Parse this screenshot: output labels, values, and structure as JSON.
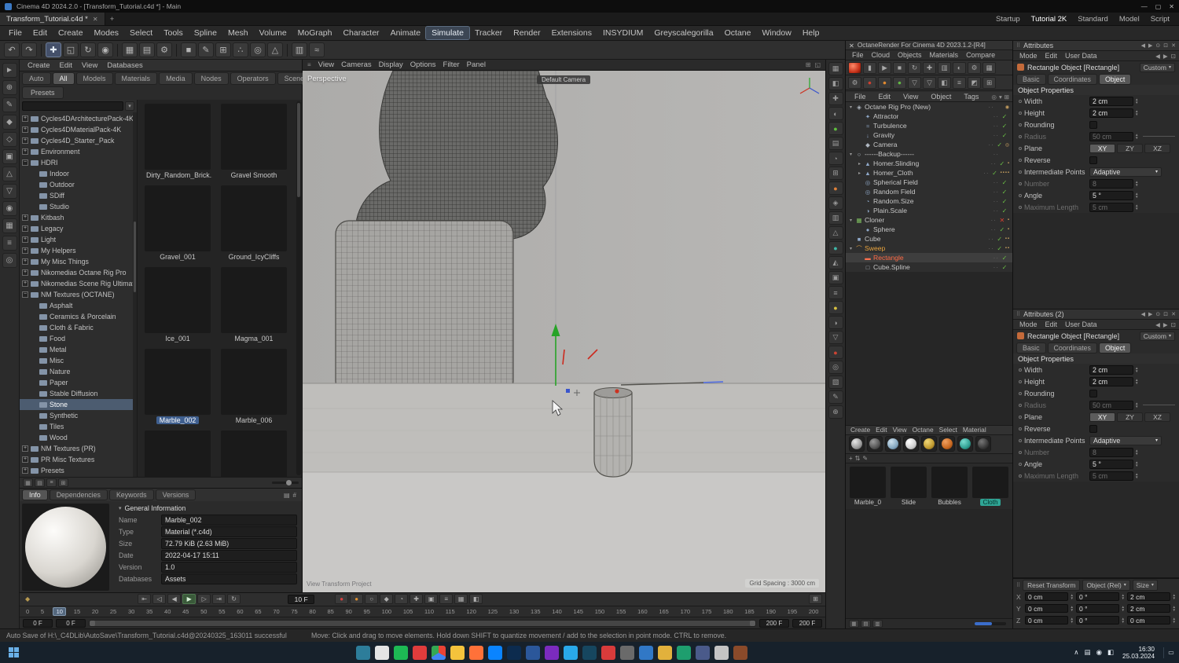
{
  "titlebar": {
    "title": "Cinema 4D 2024.2.0 - [Transform_Tutorial.c4d *] - Main",
    "min": "—",
    "max": "▢",
    "close": "✕"
  },
  "doc_tab": {
    "label": "Transform_Tutorial.c4d *",
    "close": "✕",
    "new": "+"
  },
  "layout_tabs": [
    {
      "label": "Startup"
    },
    {
      "label": "Tutorial 2K",
      "active": true
    },
    {
      "label": "Standard"
    },
    {
      "label": "Model"
    },
    {
      "label": "Script"
    }
  ],
  "menubar": {
    "items": [
      {
        "label": "File"
      },
      {
        "label": "Edit"
      },
      {
        "label": "Create"
      },
      {
        "label": "Modes"
      },
      {
        "label": "Select"
      },
      {
        "label": "Tools"
      },
      {
        "label": "Spline"
      },
      {
        "label": "Mesh"
      },
      {
        "label": "Volume"
      },
      {
        "label": "MoGraph"
      },
      {
        "label": "Character"
      },
      {
        "label": "Animate"
      },
      {
        "label": "Simulate",
        "active": true
      },
      {
        "label": "Tracker"
      },
      {
        "label": "Render"
      },
      {
        "label": "Extensions"
      },
      {
        "label": "INSYDIUM"
      },
      {
        "label": "Greyscalegorilla"
      },
      {
        "label": "Octane"
      },
      {
        "label": "Window"
      },
      {
        "label": "Help"
      }
    ]
  },
  "toolbar": {
    "items": [
      {
        "g": "↶"
      },
      {
        "g": "↷"
      },
      {
        "sep": true
      },
      {
        "g": "✚",
        "hl": true
      },
      {
        "g": "◱"
      },
      {
        "g": "↻"
      },
      {
        "g": "◉"
      },
      {
        "sep": true
      },
      {
        "g": "▦"
      },
      {
        "g": "▤"
      },
      {
        "g": "⚙"
      },
      {
        "sep": true
      },
      {
        "g": "■"
      },
      {
        "g": "✎"
      },
      {
        "g": "⊞"
      },
      {
        "g": "∴"
      },
      {
        "g": "◎"
      },
      {
        "g": "△"
      },
      {
        "sep": true
      },
      {
        "g": "▥"
      },
      {
        "g": "≈"
      }
    ]
  },
  "left_tools": {
    "items": [
      {
        "g": "►"
      },
      {
        "g": "⊕"
      },
      {
        "g": "✎"
      },
      {
        "g": "◆"
      },
      {
        "g": "◇"
      },
      {
        "g": "▣"
      },
      {
        "g": "△"
      },
      {
        "g": "▽"
      },
      {
        "g": "◉"
      },
      {
        "g": "▦"
      },
      {
        "g": "≡"
      },
      {
        "g": "◎"
      }
    ]
  },
  "browser": {
    "menus": [
      "Create",
      "Edit",
      "View",
      "Databases"
    ],
    "tabs": [
      {
        "label": "Auto"
      },
      {
        "label": "All",
        "sel": true
      },
      {
        "label": "Models"
      },
      {
        "label": "Materials"
      },
      {
        "label": "Media"
      },
      {
        "label": "Nodes"
      },
      {
        "label": "Operators"
      },
      {
        "label": "Scenes"
      }
    ],
    "presets_label": "Presets",
    "tree": [
      {
        "label": "Cycles4DArchitecturePack-4K",
        "depth": 0,
        "exp": "+"
      },
      {
        "label": "Cycles4DMaterialPack-4K",
        "depth": 0,
        "exp": "+"
      },
      {
        "label": "Cycles4D_Starter_Pack",
        "depth": 0,
        "exp": "+"
      },
      {
        "label": "Environment",
        "depth": 0,
        "exp": "+"
      },
      {
        "label": "HDRI",
        "depth": 0,
        "exp": "−"
      },
      {
        "label": "Indoor",
        "depth": 1,
        "exp": ""
      },
      {
        "label": "Outdoor",
        "depth": 1,
        "exp": ""
      },
      {
        "label": "SDiff",
        "depth": 1,
        "exp": ""
      },
      {
        "label": "Studio",
        "depth": 1,
        "exp": ""
      },
      {
        "label": "Kitbash",
        "depth": 0,
        "exp": "+"
      },
      {
        "label": "Legacy",
        "depth": 0,
        "exp": "+"
      },
      {
        "label": "Light",
        "depth": 0,
        "exp": "+"
      },
      {
        "label": "My Helpers",
        "depth": 0,
        "exp": "+"
      },
      {
        "label": "My Misc Things",
        "depth": 0,
        "exp": "+"
      },
      {
        "label": "Nikomedias Octane Rig Pro",
        "depth": 0,
        "exp": "+"
      },
      {
        "label": "Nikomedias Scene Rig Ultimate",
        "depth": 0,
        "exp": "+"
      },
      {
        "label": "NM Textures (OCTANE)",
        "depth": 0,
        "exp": "−"
      },
      {
        "label": "Asphalt",
        "depth": 1,
        "exp": ""
      },
      {
        "label": "Ceramics & Porcelain",
        "depth": 1,
        "exp": ""
      },
      {
        "label": "Cloth & Fabric",
        "depth": 1,
        "exp": ""
      },
      {
        "label": "Food",
        "depth": 1,
        "exp": ""
      },
      {
        "label": "Metal",
        "depth": 1,
        "exp": ""
      },
      {
        "label": "Misc",
        "depth": 1,
        "exp": ""
      },
      {
        "label": "Nature",
        "depth": 1,
        "exp": ""
      },
      {
        "label": "Paper",
        "depth": 1,
        "exp": ""
      },
      {
        "label": "Stable Diffusion",
        "depth": 1,
        "exp": ""
      },
      {
        "label": "Stone",
        "depth": 1,
        "exp": "",
        "selected": true
      },
      {
        "label": "Synthetic",
        "depth": 1,
        "exp": ""
      },
      {
        "label": "Tiles",
        "depth": 1,
        "exp": ""
      },
      {
        "label": "Wood",
        "depth": 1,
        "exp": ""
      },
      {
        "label": "NM Textures (PR)",
        "depth": 0,
        "exp": "+"
      },
      {
        "label": "PR Misc Textures",
        "depth": 0,
        "exp": "+"
      },
      {
        "label": "Presets",
        "depth": 0,
        "exp": "+"
      }
    ],
    "materials": [
      {
        "label": "Dirty_Random_Brick...",
        "cls": "g1"
      },
      {
        "label": "Gravel Smooth",
        "cls": "g2"
      },
      {
        "label": "Gravel_001",
        "cls": "g3"
      },
      {
        "label": "Ground_IcyCliffs",
        "cls": "g4"
      },
      {
        "label": "Ice_001",
        "cls": "g5"
      },
      {
        "label": "Magma_001",
        "cls": "g6"
      },
      {
        "label": "Marble_002",
        "cls": "g7",
        "selected": true
      },
      {
        "label": "Marble_006",
        "cls": "g8"
      },
      {
        "label": "",
        "cls": "g9"
      },
      {
        "label": "",
        "cls": "g10"
      }
    ],
    "footer_icons": [
      {
        "g": "▦"
      },
      {
        "g": "▤"
      },
      {
        "g": "≡"
      },
      {
        "g": "⊞"
      }
    ],
    "info": {
      "tabs": [
        {
          "label": "Info",
          "sel": true
        },
        {
          "label": "Dependencies"
        },
        {
          "label": "Keywords"
        },
        {
          "label": "Versions"
        }
      ],
      "section": "General Information",
      "rows": [
        {
          "k": "Name",
          "v": "Marble_002"
        },
        {
          "k": "Type",
          "v": "Material (*.c4d)"
        },
        {
          "k": "Size",
          "v": "72.79 KiB (2.63 MiB)"
        },
        {
          "k": "Date",
          "v": "2022-04-17 15:11"
        },
        {
          "k": "Version",
          "v": "1.0"
        },
        {
          "k": "Databases",
          "v": "Assets"
        }
      ]
    }
  },
  "viewport": {
    "label": "Perspective",
    "menus": [
      "View",
      "Cameras",
      "Display",
      "Options",
      "Filter",
      "Panel"
    ],
    "camera_label": "Default Camera",
    "hud_left": "View Transform Project",
    "hud_right": "Grid Spacing : 3000 cm"
  },
  "strip": {
    "items": [
      {
        "g": "▦"
      },
      {
        "g": "◧"
      },
      {
        "g": "✚"
      },
      {
        "g": "◐"
      },
      {
        "g": "●",
        "cls": "cgrn"
      },
      {
        "g": "▤"
      },
      {
        "g": "◔"
      },
      {
        "g": "⊞"
      },
      {
        "g": "●",
        "cls": "corn2"
      },
      {
        "g": "◈"
      },
      {
        "g": "▥"
      },
      {
        "g": "△"
      },
      {
        "g": "●",
        "cls": "cteal"
      },
      {
        "g": "◭"
      },
      {
        "g": "▣"
      },
      {
        "g": "≡"
      },
      {
        "g": "●",
        "cls": "cyel"
      },
      {
        "g": "◑"
      },
      {
        "g": "▽"
      },
      {
        "g": "●",
        "cls": "cred2"
      },
      {
        "g": "◎"
      },
      {
        "g": "▧"
      },
      {
        "g": "✎"
      },
      {
        "g": "⊕"
      }
    ]
  },
  "timeline": {
    "key_icon": "◆",
    "transport": [
      {
        "g": "⇤"
      },
      {
        "g": "◁"
      },
      {
        "g": "◀"
      },
      {
        "g": "▶",
        "on": true
      },
      {
        "g": "▷"
      },
      {
        "g": "⇥"
      },
      {
        "g": "↻"
      }
    ],
    "frame_field": "10 F",
    "record": [
      {
        "g": "●",
        "cls": "cred"
      },
      {
        "g": "●",
        "cls": "corn"
      },
      {
        "g": "○"
      },
      {
        "g": "◆"
      },
      {
        "g": "◔"
      },
      {
        "g": "✚"
      },
      {
        "g": "▣"
      },
      {
        "g": "≡"
      },
      {
        "g": "▦"
      },
      {
        "g": "◧"
      }
    ],
    "right_icon": "⊞",
    "ticks": [
      0,
      5,
      10,
      15,
      20,
      25,
      30,
      35,
      40,
      45,
      50,
      55,
      60,
      65,
      70,
      75,
      80,
      85,
      90,
      95,
      100,
      105,
      110,
      115,
      120,
      125,
      130,
      135,
      140,
      145,
      150,
      155,
      160,
      165,
      170,
      175,
      180,
      185,
      190,
      195,
      200
    ],
    "playhead": "10",
    "range": {
      "s1": "0 F",
      "s2": "0 F",
      "e1": "200 F",
      "e2": "200 F"
    }
  },
  "octane": {
    "close": "✕",
    "title": "OctaneRender For Cinema 4D 2023.1.2-[R4]",
    "menus": [
      "File",
      "Cloud",
      "Objects",
      "Materials",
      "Compare"
    ],
    "tb1": [
      {
        "ball": true
      },
      {
        "g": "▮"
      },
      {
        "g": "▶"
      },
      {
        "g": "■"
      },
      {
        "g": "↻"
      },
      {
        "g": "✚"
      },
      {
        "g": "▥"
      },
      {
        "g": "◐"
      },
      {
        "g": "⚙"
      },
      {
        "g": "▦"
      }
    ],
    "tb2": [
      {
        "g": "⚙"
      },
      {
        "g": "●",
        "cls": "orb-red"
      },
      {
        "g": "●",
        "cls": "orb-orn"
      },
      {
        "g": "●",
        "cls": "orb-grn"
      },
      {
        "g": "▽"
      },
      {
        "g": "▽"
      },
      {
        "g": "◧"
      },
      {
        "g": "≡"
      },
      {
        "g": "◩"
      },
      {
        "g": "⊞"
      }
    ]
  },
  "objects": {
    "menus": [
      "File",
      "Edit",
      "View",
      "Object",
      "Tags"
    ],
    "items": [
      {
        "label": "Octane Rig Pro (New)",
        "depth": 0,
        "exp": "▾",
        "ic": "◈",
        "iccls": "icg",
        "chk": "",
        "tags": "◉"
      },
      {
        "label": "Attractor",
        "depth": 1,
        "exp": "",
        "ic": "✦",
        "iccls": "icb",
        "chk": "✓",
        "tags": ""
      },
      {
        "label": "Turbulence",
        "depth": 1,
        "exp": "",
        "ic": "≈",
        "iccls": "icb",
        "chk": "✓",
        "tags": ""
      },
      {
        "label": "Gravity",
        "depth": 1,
        "exp": "",
        "ic": "↓",
        "iccls": "icb",
        "chk": "✓",
        "tags": ""
      },
      {
        "label": "Camera",
        "depth": 1,
        "exp": "",
        "ic": "◆",
        "iccls": "icg",
        "chk": "✓",
        "tags": "◎"
      },
      {
        "label": "------Backup------",
        "depth": 0,
        "exp": "▾",
        "ic": "○",
        "iccls": "icg",
        "chk": "",
        "tags": ""
      },
      {
        "label": "Homer.Slinding",
        "depth": 1,
        "exp": "▸",
        "ic": "▲",
        "iccls": "icb",
        "chk": "✓",
        "tags": "▪"
      },
      {
        "label": "Homer_Cloth",
        "depth": 1,
        "exp": "▸",
        "ic": "▲",
        "iccls": "icb",
        "chk": "✓",
        "tags": "▪▪▪▪"
      },
      {
        "label": "Spherical Field",
        "depth": 1,
        "exp": "",
        "ic": "◎",
        "iccls": "icb",
        "chk": "✓",
        "tags": ""
      },
      {
        "label": "Random Field",
        "depth": 1,
        "exp": "",
        "ic": "◎",
        "iccls": "icb",
        "chk": "✓",
        "tags": ""
      },
      {
        "label": "Random.Size",
        "depth": 1,
        "exp": "",
        "ic": "◔",
        "iccls": "icb",
        "chk": "✓",
        "tags": ""
      },
      {
        "label": "Plain.Scale",
        "depth": 1,
        "exp": "",
        "ic": "◑",
        "iccls": "icb",
        "chk": "✓",
        "tags": ""
      },
      {
        "label": "Cloner",
        "depth": 0,
        "exp": "▾",
        "ic": "▦",
        "iccls": "icgr",
        "chk": "✕",
        "red": true,
        "tags": "▪"
      },
      {
        "label": "Sphere",
        "depth": 1,
        "exp": "",
        "ic": "●",
        "iccls": "icb",
        "chk": "✓",
        "tags": "▪"
      },
      {
        "label": "Cube",
        "depth": 0,
        "exp": "",
        "ic": "■",
        "iccls": "icb",
        "chk": "✓",
        "tags": "▪▪"
      },
      {
        "label": "Sweep",
        "depth": 0,
        "exp": "▾",
        "ic": "⌒",
        "iccls": "ico",
        "lbl": "lo",
        "chk": "✓",
        "tags": "▪▪"
      },
      {
        "label": "Rectangle",
        "depth": 1,
        "exp": "",
        "ic": "▬",
        "iccls": "icr",
        "lbl": "lr",
        "selected": true,
        "chk": "✓",
        "tags": ""
      },
      {
        "label": "Cube.Spline",
        "depth": 1,
        "exp": "",
        "ic": "□",
        "iccls": "icg",
        "chk": "✓",
        "tags": ""
      }
    ]
  },
  "materials_mgr": {
    "menus": [
      "Create",
      "Edit",
      "View",
      "Octane",
      "Select",
      "Material"
    ],
    "spheres": [
      {
        "cls": "sp1"
      },
      {
        "cls": "sp2"
      },
      {
        "cls": "sp3"
      },
      {
        "cls": "sp4"
      },
      {
        "cls": "sp5"
      },
      {
        "cls": "sp6"
      },
      {
        "cls": "sp7"
      },
      {
        "cls": "sp8"
      }
    ],
    "tools": [
      {
        "g": "+"
      },
      {
        "g": "⇅"
      },
      {
        "g": "✎"
      }
    ],
    "items": [
      {
        "label": "Marble_0",
        "cls": "mg1"
      },
      {
        "label": "Slide",
        "cls": "mg2"
      },
      {
        "label": "Bubbles",
        "cls": "mg3"
      },
      {
        "label": "Cloth",
        "cls": "mg4",
        "selected": true
      }
    ]
  },
  "attr_panel": {
    "title1": "Attributes",
    "title2": "Attributes (2)",
    "menus": [
      "Mode",
      "Edit",
      "User Data"
    ],
    "win_icons": [
      {
        "g": "◀"
      },
      {
        "g": "▶"
      },
      {
        "g": "⊙"
      },
      {
        "g": "⊡"
      },
      {
        "g": "✕"
      }
    ],
    "object_label": "Rectangle Object [Rectangle]",
    "preset": "Custom",
    "tabs": [
      {
        "label": "Basic"
      },
      {
        "label": "Coordinates"
      },
      {
        "label": "Object",
        "sel": true
      }
    ],
    "section": "Object Properties",
    "rows": [
      {
        "label": "Width",
        "is_value": true,
        "value": "2 cm"
      },
      {
        "label": "Height",
        "is_value": true,
        "value": "2 cm"
      },
      {
        "label": "Rounding",
        "is_check": true
      },
      {
        "label": "Radius",
        "is_value": true,
        "value": "50 cm",
        "disabled": true,
        "has_slider": true
      },
      {
        "label": "Plane",
        "is_buttons": true,
        "b1": "XY",
        "b2": "ZY",
        "b3": "XZ",
        "b1_on": true
      },
      {
        "label": "Reverse",
        "is_check": true
      },
      {
        "label": "Intermediate Points",
        "is_drop": true,
        "value": "Adaptive"
      },
      {
        "label": "Number",
        "is_value": true,
        "value": "8",
        "disabled": true
      },
      {
        "label": "Angle",
        "is_value": true,
        "value": "5 °"
      },
      {
        "label": "Maximum Length",
        "is_value": true,
        "value": "5 cm",
        "disabled": true
      }
    ]
  },
  "coords": {
    "reset": "Reset Transform",
    "mode": "Object (Rel)",
    "size": "Size",
    "rows": [
      {
        "axis": "X",
        "p": "0 cm",
        "r": "0 °",
        "s": "2 cm"
      },
      {
        "axis": "Y",
        "p": "0 cm",
        "r": "0 °",
        "s": "2 cm"
      },
      {
        "axis": "Z",
        "p": "0 cm",
        "r": "0 °",
        "s": "0 cm"
      }
    ]
  },
  "statusbar": {
    "left": "Auto Save of H:\\_C4DLib\\AutoSave\\Transform_Tutorial.c4d@20240325_163011 successful",
    "right": "Move: Click and drag to move elements. Hold down SHIFT to quantize movement / add to the selection in point mode. CTRL to remove."
  },
  "taskbar": {
    "apps": [
      {
        "cls": "a1"
      },
      {
        "cls": "a2"
      },
      {
        "cls": "a3"
      },
      {
        "cls": "a4"
      },
      {
        "cls": "a5"
      },
      {
        "cls": "a6"
      },
      {
        "cls": "a7"
      },
      {
        "cls": "a8"
      },
      {
        "cls": "a9"
      },
      {
        "cls": "a10"
      },
      {
        "cls": "a11"
      },
      {
        "cls": "a12"
      },
      {
        "cls": "a13"
      },
      {
        "cls": "a14"
      },
      {
        "cls": "a15"
      },
      {
        "cls": "a16"
      },
      {
        "cls": "a17"
      },
      {
        "cls": "a18"
      },
      {
        "cls": "a19"
      },
      {
        "cls": "a20"
      },
      {
        "cls": "a21"
      }
    ],
    "tray": [
      {
        "g": "∧"
      },
      {
        "g": "▤"
      },
      {
        "g": "◉"
      },
      {
        "g": "◧"
      }
    ],
    "time": "16:30",
    "date": "25.03.2024",
    "notif": "▭"
  }
}
